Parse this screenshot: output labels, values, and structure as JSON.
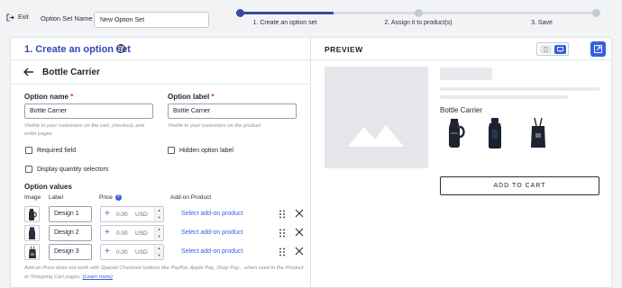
{
  "topbar": {
    "exit_label": "Exit",
    "set_name_label": "Option Set Name",
    "set_name_value": "New Option Set"
  },
  "steps": [
    {
      "label": "1. Create an option set",
      "state": "active"
    },
    {
      "label": "2. Assign it to product(s)",
      "state": "pending"
    },
    {
      "label": "3. Save",
      "state": "pending"
    }
  ],
  "panel": {
    "title": "1. Create an option set",
    "option_title": "Bottle Carrier"
  },
  "form": {
    "option_name_label": "Option name",
    "option_name_value": "Bottle Carrier",
    "option_name_help": "Visible to your customers on the cart, checkout, and order pages",
    "option_label_label": "Option label",
    "option_label_value": "Bottle Carrier",
    "option_label_help": "Visible to your customers on the product",
    "required_field": "Required field",
    "hidden_label": "Hidden option label",
    "display_quantity": "Display quantity selectors"
  },
  "values": {
    "section_title": "Option values",
    "headers": {
      "image": "Image",
      "label": "Label",
      "price": "Price",
      "addon": "Add-on Product"
    },
    "rows": [
      {
        "label": "Design 1",
        "price": "0.00",
        "currency": "USD",
        "addon": "Select add-on product"
      },
      {
        "label": "Design 2",
        "price": "0.00",
        "currency": "USD",
        "addon": "Select add-on product"
      },
      {
        "label": "Design 3",
        "price": "0.00",
        "currency": "USD",
        "addon": "Select add-on product"
      }
    ],
    "note": "Add-on Price does not work with Special Checkout buttons like PayPal, Apple Pay, Shop Pay... when used in the Product or Shopping Cart pages.",
    "learn_more": "(Learn more)"
  },
  "preview": {
    "title": "PREVIEW",
    "option_label": "Bottle Carrier",
    "add_to_cart": "ADD TO CART"
  },
  "colors": {
    "accent": "#3560e0",
    "step_active": "#3a4a9c",
    "title": "#3048b8"
  }
}
